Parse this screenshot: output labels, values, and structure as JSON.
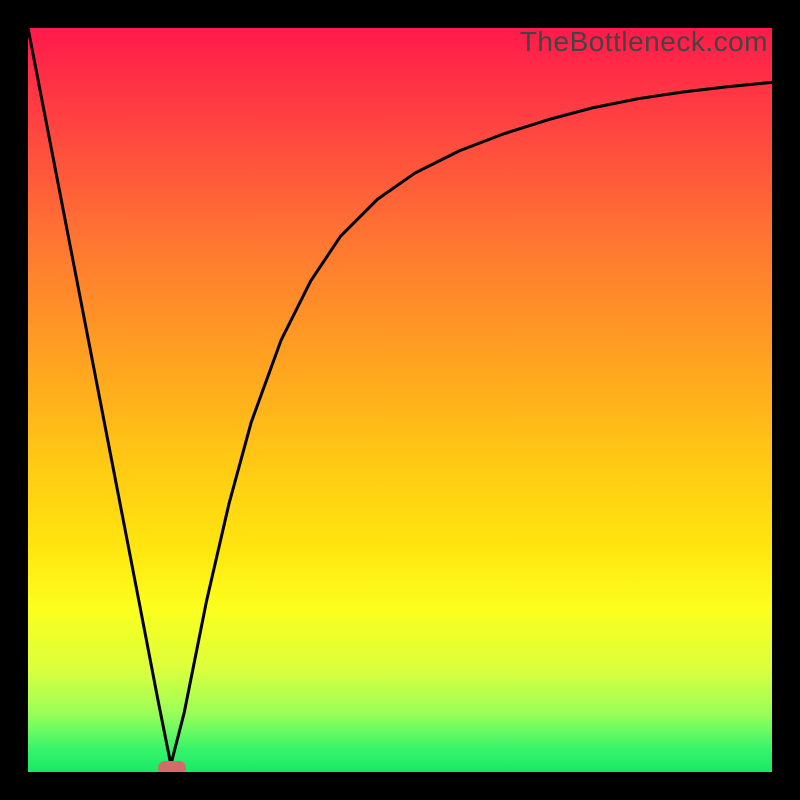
{
  "watermark": "TheBottleneck.com",
  "chart_data": {
    "type": "line",
    "title": "",
    "xlabel": "",
    "ylabel": "",
    "xlim": [
      0,
      1
    ],
    "ylim": [
      0,
      1
    ],
    "series": [
      {
        "name": "curve",
        "x": [
          0.0,
          0.03,
          0.06,
          0.09,
          0.12,
          0.15,
          0.175,
          0.192,
          0.21,
          0.24,
          0.27,
          0.3,
          0.34,
          0.38,
          0.42,
          0.47,
          0.52,
          0.58,
          0.64,
          0.7,
          0.76,
          0.82,
          0.88,
          0.94,
          1.0
        ],
        "y": [
          1.0,
          0.845,
          0.69,
          0.535,
          0.38,
          0.225,
          0.095,
          0.01,
          0.08,
          0.23,
          0.36,
          0.47,
          0.58,
          0.66,
          0.72,
          0.77,
          0.805,
          0.835,
          0.858,
          0.877,
          0.893,
          0.905,
          0.914,
          0.921,
          0.927
        ]
      }
    ],
    "marker": {
      "x": 0.194,
      "y": 0.005,
      "color": "#d56a6a"
    },
    "background_gradient": {
      "direction": "top-to-bottom",
      "stops": [
        {
          "pos": 0.0,
          "color": "#ff1a4a"
        },
        {
          "pos": 0.15,
          "color": "#ff4a3f"
        },
        {
          "pos": 0.3,
          "color": "#ff7a30"
        },
        {
          "pos": 0.45,
          "color": "#ffa320"
        },
        {
          "pos": 0.58,
          "color": "#ffc814"
        },
        {
          "pos": 0.7,
          "color": "#ffe60f"
        },
        {
          "pos": 0.78,
          "color": "#fcff1e"
        },
        {
          "pos": 0.86,
          "color": "#dcff3c"
        },
        {
          "pos": 0.92,
          "color": "#9cff58"
        },
        {
          "pos": 1.0,
          "color": "#18e864"
        }
      ]
    }
  }
}
